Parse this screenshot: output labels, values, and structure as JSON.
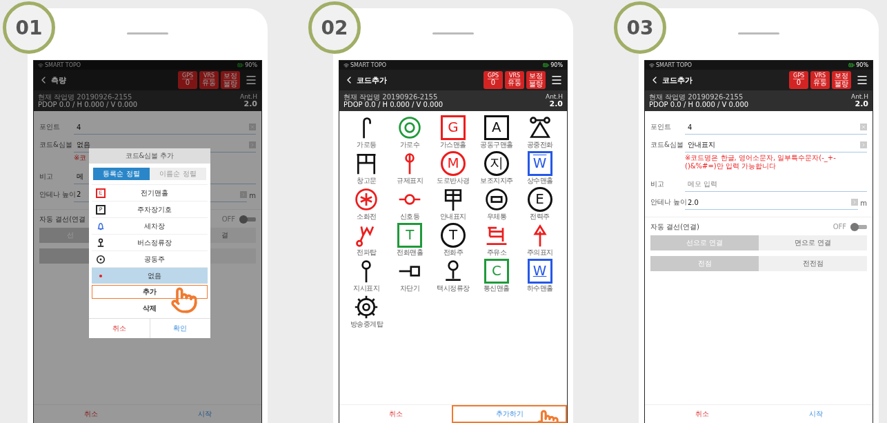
{
  "screens": [
    {
      "step": "01",
      "kind": "dialog",
      "status": {
        "app": "SMART TOPO",
        "battery": "90%"
      },
      "title": "측량",
      "badges": [
        {
          "label": "GPS",
          "value": "0"
        },
        {
          "label": "VRS",
          "value": "유동"
        },
        {
          "label": "보정",
          "value": "불량"
        }
      ],
      "job": "현재 작업명 20190926-2155",
      "precision": "PDOP 0.0 / H 0.000 / V 0.000",
      "ant_label": "Ant.H",
      "ant_value": "2.0",
      "form": {
        "fields": [
          {
            "label": "포인트",
            "value": "4",
            "kind": "clear"
          },
          {
            "label": "코드&심볼",
            "value": "없음",
            "kind": "next",
            "hint": "※코"
          },
          {
            "label": "비고",
            "value": "메",
            "kind": "plain"
          },
          {
            "label": "안테나 높이",
            "value": "2",
            "kind": "next",
            "unit": "m"
          }
        ],
        "auto_connect": {
          "label": "자동 결선(연결",
          "state": "OFF",
          "on": false
        },
        "segments": [
          [
            {
              "label": "선",
              "selected": true
            },
            {
              "label": "결",
              "selected": false
            }
          ],
          [
            {
              "selected": true
            },
            {
              "selected": false
            }
          ]
        ]
      },
      "dialog": {
        "title": "코드&심볼 추가",
        "tabs": [
          {
            "label": "등록순 정렬",
            "selected": true
          },
          {
            "label": "이름순 정렬",
            "selected": false
          }
        ],
        "items": [
          {
            "label": "전기맨홀",
            "kind": "boxed",
            "letter": "E",
            "color": "#e52222",
            "selected": false
          },
          {
            "label": "주차장기호",
            "kind": "boxed",
            "letter": "P",
            "color": "#222222",
            "selected": false
          },
          {
            "label": "세차장",
            "kind": "bell",
            "color": "#3b6fe0",
            "selected": false
          },
          {
            "label": "버스정류장",
            "kind": "stop",
            "color": "#222222",
            "selected": false
          },
          {
            "label": "공동주",
            "kind": "ring",
            "color": "#222222",
            "selected": false
          },
          {
            "label": "없음",
            "kind": "dot",
            "color": "#e52222",
            "selected": true
          }
        ],
        "actions": [
          {
            "label": "추가",
            "highlighted": true
          },
          {
            "label": "삭제",
            "highlighted": false
          }
        ],
        "buttons": [
          {
            "label": "취소",
            "kind": "cancel"
          },
          {
            "label": "확인",
            "kind": "confirm"
          }
        ]
      },
      "footer": [
        {
          "label": "취소",
          "kind": "cancel",
          "highlighted": false
        },
        {
          "label": "시작",
          "kind": "confirm",
          "highlighted": false
        }
      ]
    },
    {
      "step": "02",
      "kind": "symbols",
      "status": {
        "app": "SMART TOPO",
        "battery": "90%"
      },
      "title": "코드추가",
      "badges": [
        {
          "label": "GPS",
          "value": "0"
        },
        {
          "label": "VRS",
          "value": "유동"
        },
        {
          "label": "보정",
          "value": "불량"
        }
      ],
      "job": "현재 작업명 20190926-2155",
      "precision": "PDOP 0.0 / H 0.000 / V 0.000",
      "ant_label": "Ant.H",
      "ant_value": "2.0",
      "symbols": [
        {
          "label": "가로등",
          "kind": "lamp",
          "color": "#111111"
        },
        {
          "label": "가로수",
          "kind": "double-ring",
          "color": "#1f9a3a"
        },
        {
          "label": "가스맨홀",
          "kind": "boxed",
          "letter": "G",
          "color": "#ee1c1c"
        },
        {
          "label": "공동구맨홀",
          "kind": "boxed",
          "letter": "A",
          "color": "#111111"
        },
        {
          "label": "공중전화",
          "kind": "phone",
          "color": "#111111"
        },
        {
          "label": "창고문",
          "kind": "gate",
          "color": "#111111"
        },
        {
          "label": "규제표지",
          "kind": "sign-pin",
          "color": "#ee1c1c"
        },
        {
          "label": "도로반사경",
          "kind": "circled",
          "letter": "M",
          "color": "#ee1c1c"
        },
        {
          "label": "보조지지주",
          "kind": "circled",
          "letter": "지",
          "color": "#111111"
        },
        {
          "label": "상수맨홀",
          "kind": "boxed-overline",
          "letter": "W",
          "color": "#2458e8"
        },
        {
          "label": "소화전",
          "kind": "asterisk",
          "color": "#ee1c1c"
        },
        {
          "label": "신호등",
          "kind": "signal",
          "color": "#ee1c1c"
        },
        {
          "label": "안내표지",
          "kind": "tower-sign",
          "color": "#111111"
        },
        {
          "label": "우체통",
          "kind": "postbox",
          "color": "#111111"
        },
        {
          "label": "전력주",
          "kind": "circled",
          "letter": "E",
          "color": "#111111"
        },
        {
          "label": "전파탑",
          "kind": "antenna",
          "color": "#ee1c1c"
        },
        {
          "label": "전화맨홀",
          "kind": "boxed",
          "letter": "T",
          "color": "#1f9a3a"
        },
        {
          "label": "전화주",
          "kind": "circled",
          "letter": "T",
          "color": "#111111"
        },
        {
          "label": "주유소",
          "kind": "pump",
          "color": "#ee1c1c"
        },
        {
          "label": "주의표지",
          "kind": "arrow",
          "color": "#ee1c1c"
        },
        {
          "label": "지시표지",
          "kind": "pin",
          "color": "#111111"
        },
        {
          "label": "차단기",
          "kind": "barrier",
          "color": "#111111"
        },
        {
          "label": "택시정류장",
          "kind": "stop",
          "color": "#111111"
        },
        {
          "label": "통신맨홀",
          "kind": "boxed",
          "letter": "C",
          "color": "#1f9a3a"
        },
        {
          "label": "하수맨홀",
          "kind": "boxed-underline",
          "letter": "W",
          "color": "#2458e8"
        },
        {
          "label": "방송중계탑",
          "kind": "gear",
          "color": "#111111"
        }
      ],
      "footer": [
        {
          "label": "취소",
          "kind": "cancel",
          "highlighted": false
        },
        {
          "label": "추가하기",
          "kind": "confirm",
          "highlighted": true
        }
      ]
    },
    {
      "step": "03",
      "kind": "form",
      "status": {
        "app": "SMART TOPO",
        "battery": "90%"
      },
      "title": "코드추가",
      "badges": [
        {
          "label": "GPS",
          "value": "0"
        },
        {
          "label": "VRS",
          "value": "유동"
        },
        {
          "label": "보정",
          "value": "불량"
        }
      ],
      "job": "현재 작업명 20190926-2155",
      "precision": "PDOP 0.0 / H 0.000 / V 0.000",
      "ant_label": "Ant.H",
      "ant_value": "2.0",
      "form": {
        "fields": [
          {
            "label": "포인트",
            "value": "4",
            "kind": "clear"
          },
          {
            "label": "코드&심볼",
            "value": "안내표지",
            "kind": "next",
            "hint": "※코드명은 한글, 영어소문자, 일부특수문자(-_+-()&%#=)만 입력 가능합니다"
          },
          {
            "label": "비고",
            "placeholder": "메모 입력",
            "kind": "plain"
          },
          {
            "label": "안테나 높이",
            "value": "2.0",
            "kind": "next",
            "unit": "m"
          }
        ],
        "auto_connect": {
          "label": "자동 결선(연결)",
          "state": "OFF",
          "on": false
        },
        "segments": [
          [
            {
              "label": "선으로 연결",
              "selected": true
            },
            {
              "label": "면으로 연결",
              "selected": false
            }
          ],
          [
            {
              "label": "전점",
              "selected": true
            },
            {
              "label": "전전점",
              "selected": false
            }
          ]
        ]
      },
      "footer": [
        {
          "label": "취소",
          "kind": "cancel",
          "highlighted": false
        },
        {
          "label": "시작",
          "kind": "confirm",
          "highlighted": false
        }
      ]
    }
  ]
}
